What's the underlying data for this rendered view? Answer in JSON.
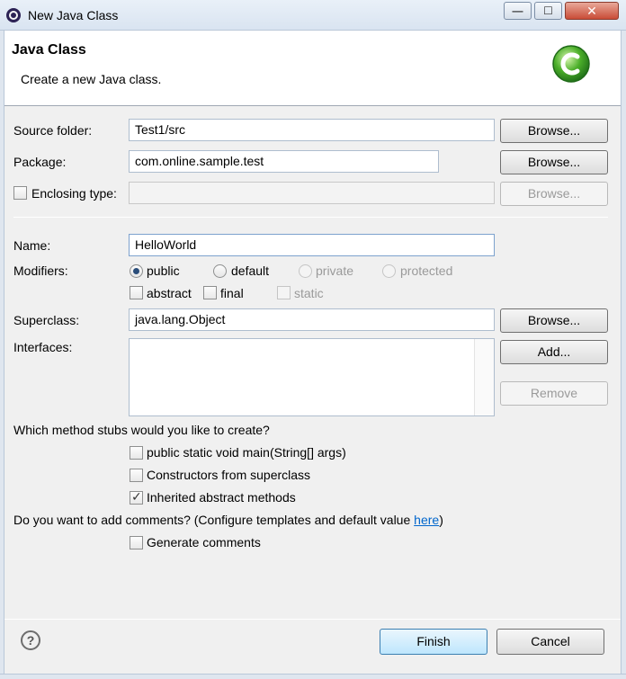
{
  "window": {
    "title": "New Java Class",
    "minimize_glyph": "—",
    "maximize_glyph": "☐",
    "close_glyph": "✕"
  },
  "header": {
    "title": "Java Class",
    "description": "Create a new Java class.",
    "icon": "java-class-c-icon"
  },
  "source_folder": {
    "label": "Source folder:",
    "value": "Test1/src",
    "browse_label": "Browse..."
  },
  "package": {
    "label": "Package:",
    "value": "com.online.sample.test",
    "browse_label": "Browse..."
  },
  "enclosing_type": {
    "label": "Enclosing type:",
    "checked": false,
    "value": "",
    "browse_label": "Browse..."
  },
  "name": {
    "label": "Name:",
    "value": "HelloWorld"
  },
  "modifiers": {
    "label": "Modifiers:",
    "access": [
      {
        "label": "public",
        "selected": true,
        "enabled": true
      },
      {
        "label": "default",
        "selected": false,
        "enabled": true
      },
      {
        "label": "private",
        "selected": false,
        "enabled": false
      },
      {
        "label": "protected",
        "selected": false,
        "enabled": false
      }
    ],
    "other": [
      {
        "label": "abstract",
        "checked": false,
        "enabled": true
      },
      {
        "label": "final",
        "checked": false,
        "enabled": true
      },
      {
        "label": "static",
        "checked": false,
        "enabled": false
      }
    ]
  },
  "superclass": {
    "label": "Superclass:",
    "value": "java.lang.Object",
    "browse_label": "Browse..."
  },
  "interfaces": {
    "label": "Interfaces:",
    "add_label": "Add...",
    "remove_label": "Remove"
  },
  "stubs": {
    "question": "Which method stubs would you like to create?",
    "options": [
      {
        "label": "public static void main(String[] args)",
        "checked": false
      },
      {
        "label": "Constructors from superclass",
        "checked": false
      },
      {
        "label": "Inherited abstract methods",
        "checked": true
      }
    ]
  },
  "comments": {
    "question_prefix": "Do you want to add comments? (Configure templates and default value ",
    "link": "here",
    "question_suffix": ")",
    "option": {
      "label": "Generate comments",
      "checked": false
    }
  },
  "footer": {
    "help_glyph": "?",
    "finish_label": "Finish",
    "cancel_label": "Cancel"
  },
  "colors": {
    "link": "#0066cc",
    "dialog_bg": "#f0f0f0",
    "icon_green": "#4caf2a"
  }
}
